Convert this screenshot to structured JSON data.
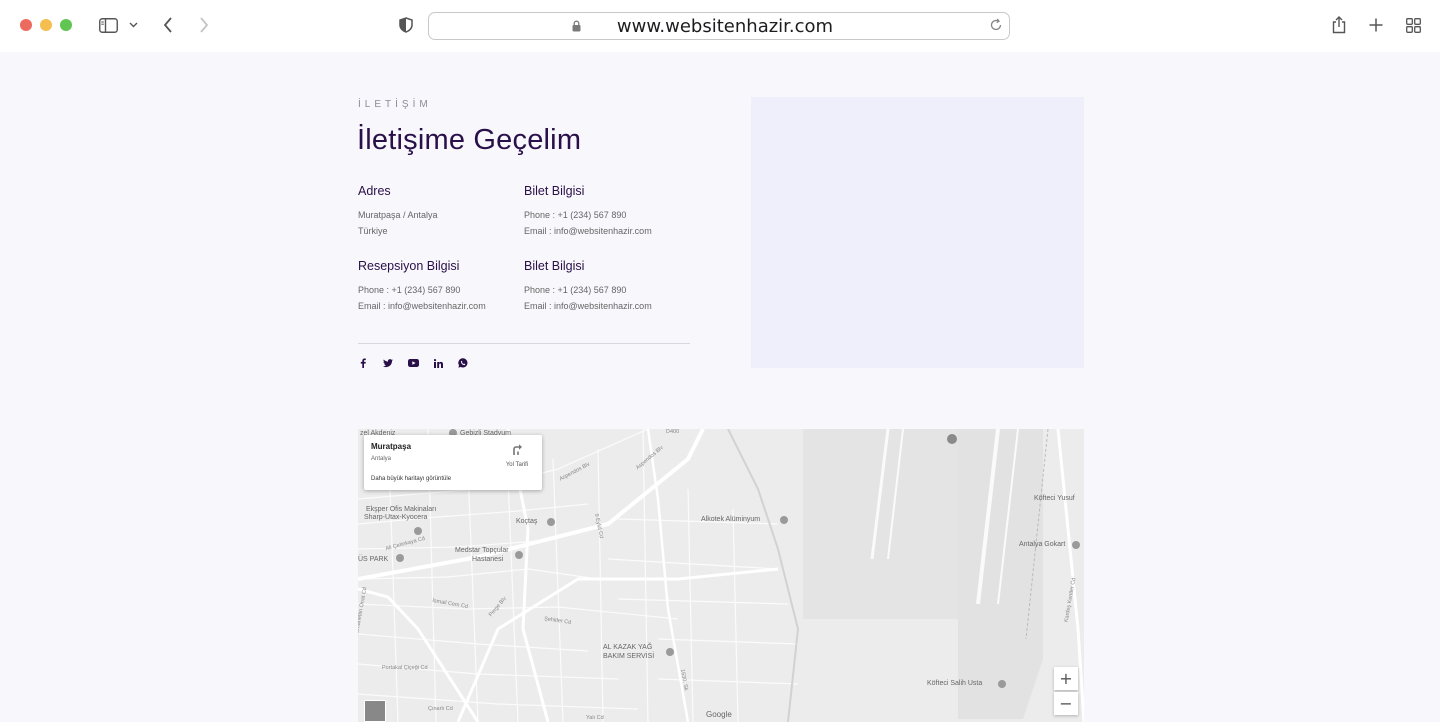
{
  "browser": {
    "url": "www.websitenhazir.com"
  },
  "contact": {
    "eyebrow": "İLETİŞİM",
    "headline": "İletişime Geçelim",
    "blocks": [
      {
        "title": "Adres",
        "lines": [
          "Muratpaşa / Antalya",
          "Türkiye"
        ]
      },
      {
        "title": "Bilet Bilgisi",
        "lines": [
          "Phone : +1 (234) 567 890",
          "Email : info@websitenhazir.com"
        ]
      },
      {
        "title": "Resepsiyon Bilgisi",
        "lines": [
          "Phone : +1 (234) 567 890",
          "Email : info@websitenhazir.com"
        ]
      },
      {
        "title": "Bilet Bilgisi",
        "lines": [
          "Phone : +1 (234) 567 890",
          "Email : info@websitenhazir.com"
        ]
      }
    ],
    "socials": [
      "facebook-icon",
      "twitter-icon",
      "youtube-icon",
      "linkedin-icon",
      "whatsapp-icon"
    ]
  },
  "map": {
    "card": {
      "title": "Muratpaşa",
      "subtitle": "Antalya",
      "directions": "Yol Tarifi",
      "larger_map": "Daha büyük haritayı görüntüle"
    },
    "labels": [
      "zel Akdeniz",
      "Gebizli Stadyum",
      "Ekşper Ofis Makinaları",
      "Sharp-Utax-Kyocera",
      "Koçtaş",
      "Alkotek Alüminyum",
      "Antalya Gokart",
      "Köfteci Yusuf",
      "Medstar Topçular",
      "Hastanesi",
      "ÜS PARK",
      "AL KAZAK YAĞ",
      "BAKIM SERVİSİ",
      "Köfteci Salih Usta",
      "Google"
    ],
    "streets": [
      "Aspendos Blv",
      "Aspendos Blv",
      "9 Eylül Cd",
      "Ali Çetinkaya Cd",
      "İsmail Cem Cd",
      "Perge Blv",
      "Şehitler Cd",
      "Portakal Çiçeği Cd",
      "Burhanettin Onat Cd",
      "Çınarlı Cd",
      "Yalı Cd",
      "1630. Sk",
      "Kardeş Kentler Cd",
      "D400"
    ],
    "zoom_in": "+",
    "zoom_out": "−"
  }
}
